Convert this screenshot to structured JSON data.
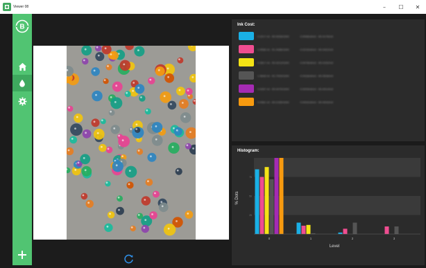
{
  "window": {
    "title": "Viewer 08",
    "minimize": "–",
    "maximize": "☐",
    "close": "✕"
  },
  "sidebar": {
    "logo": "B",
    "items": [
      {
        "icon": "home-icon"
      },
      {
        "icon": "droplet-icon",
        "active": true
      },
      {
        "icon": "gear-icon"
      }
    ],
    "add_icon": "plus-icon"
  },
  "colors": {
    "sidebar": "#51c472",
    "ink": [
      "#1ab0e6",
      "#ef4d90",
      "#f4e315",
      "#555555",
      "#a52bb3",
      "#f79a0f"
    ]
  },
  "ink_cost": {
    "title": "Ink Cost:",
    "rows": [
      {
        "color": "#1ab0e6",
        "value": "0.2217 ml - €0.5328/1000",
        "area": "0.0096ml/m2 - €0.0176/m2"
      },
      {
        "color": "#ef4d90",
        "value": "0.0558 ml - €1.4088/1000",
        "area": "0.0215ml/m2 - €0.0422/m2"
      },
      {
        "color": "#f4e315",
        "value": "0.2817 ml - €0.4213/1000",
        "area": "0.0078ml/m2 - €0.0152/m2"
      },
      {
        "color": "#555555",
        "value": "1.0648 ml - €1.7933/1000",
        "area": "0.0318ml/m2 - €0.0528/m2"
      },
      {
        "color": "#a52bb3",
        "value": "0.0287 ml - €0.0475/1000",
        "area": "0.0009ml/m2 - €0.0014/m2"
      },
      {
        "color": "#f79a0f",
        "value": "0.0981 ml - €0.2155/1000",
        "area": "0.0002ml/m2 - €0.0003/m2"
      }
    ]
  },
  "histogram": {
    "title": "Histogram:",
    "ylabel": "% Dots",
    "xlabel": "Level"
  },
  "chart_data": {
    "type": "bar",
    "categories": [
      "0",
      "1",
      "2",
      "3"
    ],
    "ylim": [
      0,
      100
    ],
    "yticks": [
      25,
      50,
      75
    ],
    "series": [
      {
        "color": "#1ab0e6",
        "values": [
          85,
          15,
          2,
          0
        ]
      },
      {
        "color": "#ef4d90",
        "values": [
          75,
          11,
          7,
          10
        ]
      },
      {
        "color": "#f4e315",
        "values": [
          88,
          12,
          0,
          0
        ]
      },
      {
        "color": "#555555",
        "values": [
          72,
          1,
          15,
          10
        ]
      },
      {
        "color": "#a52bb3",
        "values": [
          100,
          0,
          0,
          0
        ]
      },
      {
        "color": "#f79a0f",
        "values": [
          100,
          0,
          0,
          0
        ]
      }
    ]
  }
}
